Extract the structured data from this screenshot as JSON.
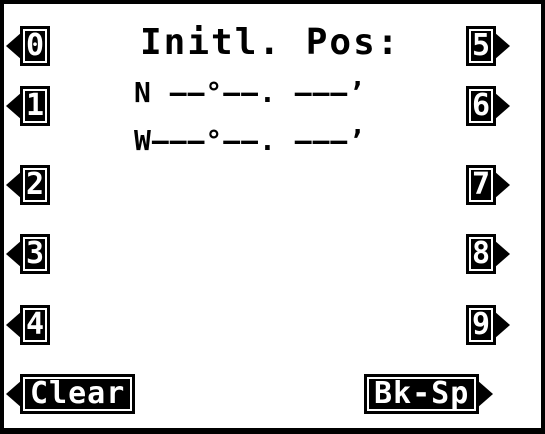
{
  "title": "Initl. Pos:",
  "position": {
    "north_line": "N ——°——. ———’",
    "west_line": "W———°——. ———’"
  },
  "keys": {
    "k0": "0",
    "k1": "1",
    "k2": "2",
    "k3": "3",
    "k4": "4",
    "k5": "5",
    "k6": "6",
    "k7": "7",
    "k8": "8",
    "k9": "9",
    "clear": "Clear",
    "backspace": "Bk-Sp"
  },
  "icons": {
    "left_keys": "left-arrow-icon",
    "right_keys": "right-arrow-icon"
  },
  "colors": {
    "background": "#ffffff",
    "foreground": "#000000"
  }
}
